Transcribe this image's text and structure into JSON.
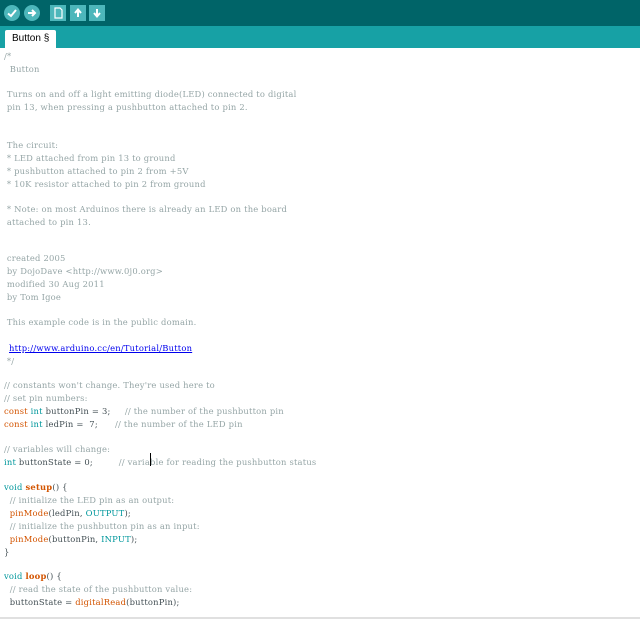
{
  "toolbar": {
    "verify_icon": "check-icon",
    "upload_icon": "arrow-right-icon",
    "new_icon": "document-icon",
    "open_icon": "arrow-up-icon",
    "save_icon": "arrow-down-icon"
  },
  "tab": {
    "label": "Button §"
  },
  "colors": {
    "toolbar": "#006468",
    "tabbar": "#17a1a5",
    "keyword": "#d35400",
    "type": "#00979c"
  },
  "code": {
    "l1": "/*",
    "l2": "  Button",
    "l3": " Turns on and off a light emitting diode(LED) connected to digital",
    "l4": " pin 13, when pressing a pushbutton attached to pin 2.",
    "l5": " The circuit:",
    "l6": " * LED attached from pin 13 to ground",
    "l7": " * pushbutton attached to pin 2 from +5V",
    "l8": " * 10K resistor attached to pin 2 from ground",
    "l9": " * Note: on most Arduinos there is already an LED on the board",
    "l10": " attached to pin 13.",
    "l11": " created 2005",
    "l12": " by DojoDave <http://www.0j0.org>",
    "l13": " modified 30 Aug 2011",
    "l14": " by Tom Igoe",
    "l15": " This example code is in the public domain.",
    "link": "http://www.arduino.cc/en/Tutorial/Button",
    "l16": " */",
    "c1": "// constants won't change. They're used here to",
    "c2": "// set pin numbers:",
    "d1_kw": "const",
    "d1_ty": "int",
    "d1_rest": " buttonPin = 3;     ",
    "d1_cm": "// the number of the pushbutton pin",
    "d2_kw": "const",
    "d2_ty": "int",
    "d2_rest": " ledPin =  7;      ",
    "d2_cm": "// the number of the LED pin",
    "c3": "// variables will change:",
    "v1_ty": "int",
    "v1_rest": " buttonState = 0;         ",
    "v1_cm": "// variable for reading the pushbutton status",
    "s_ty": "void",
    "s_fn": "setup",
    "s_rest": "() {",
    "s_c1": "  // initialize the LED pin as an output:",
    "s_fn2": "pinMode",
    "s_a1": "(ledPin, ",
    "s_k1": "OUTPUT",
    "s_e1": ");",
    "s_c2": "  // initialize the pushbutton pin as an input:",
    "s_a2": "(buttonPin, ",
    "s_k2": "INPUT",
    "s_e2": ");",
    "close": "}",
    "lp_ty": "void",
    "lp_fn": "loop",
    "lp_rest": "() {",
    "lp_c1": "  // read the state of the pushbutton value:",
    "lp_a": "  buttonState = ",
    "lp_fn2": "digitalRead",
    "lp_b": "(buttonPin);"
  }
}
